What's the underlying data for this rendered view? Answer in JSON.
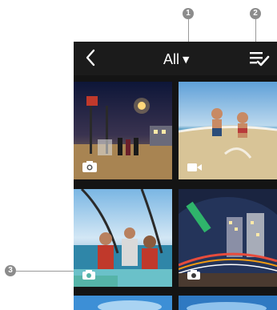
{
  "header": {
    "back_icon": "chevron-left-icon",
    "filter_label": "All",
    "filter_caret": "▼",
    "select_icon": "multi-select-check-icon"
  },
  "callouts": [
    {
      "label": "1"
    },
    {
      "label": "2"
    },
    {
      "label": "3"
    }
  ],
  "gallery": {
    "items": [
      {
        "type": "360-photo",
        "badge_icon": "360-photo-icon"
      },
      {
        "type": "video",
        "badge_icon": "video-camera-icon"
      },
      {
        "type": "photo",
        "badge_icon": "camera-icon"
      },
      {
        "type": "360-photo",
        "badge_icon": "360-photo-icon"
      },
      {
        "type": "unknown"
      },
      {
        "type": "unknown"
      }
    ]
  }
}
